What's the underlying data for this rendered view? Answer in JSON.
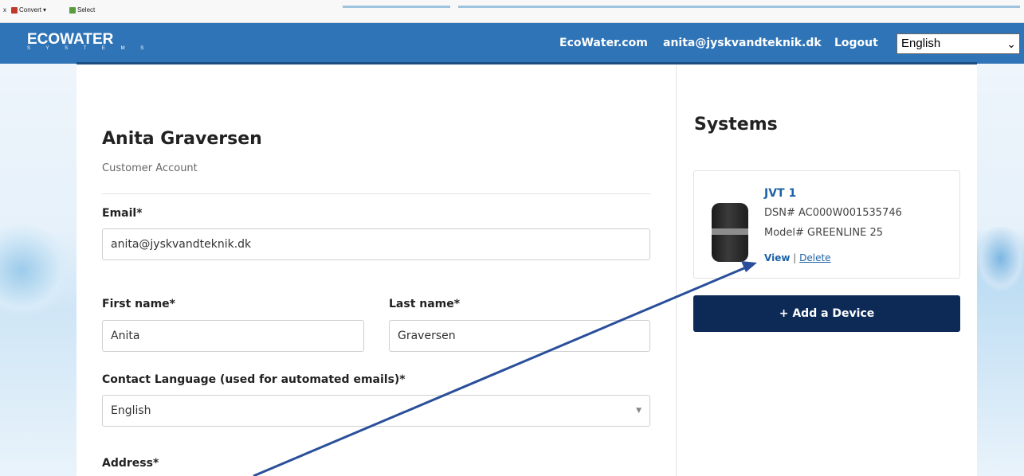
{
  "toolbar": {
    "close": "x",
    "convert_label": "Convert",
    "select_label": "Select"
  },
  "header": {
    "logo_text": "ECOWATER",
    "logo_sub": "S Y S T E M S",
    "nav": [
      {
        "label": "EcoWater.com"
      },
      {
        "label": "anita@jyskvandteknik.dk"
      },
      {
        "label": "Logout"
      }
    ],
    "language": "English"
  },
  "profile": {
    "name": "Anita Graversen",
    "subtitle": "Customer Account",
    "email_label": "Email*",
    "email_value": "anita@jyskvandteknik.dk",
    "first_name_label": "First name*",
    "first_name_value": "Anita",
    "last_name_label": "Last name*",
    "last_name_value": "Graversen",
    "contact_language_label": "Contact Language (used for automated emails)*",
    "contact_language_value": "English",
    "address_label": "Address*"
  },
  "systems": {
    "title": "Systems",
    "devices": [
      {
        "name": "JVT 1",
        "dsn": "DSN# AC000W001535746",
        "model": "Model# GREENLINE 25",
        "view_label": "View",
        "separator": "|",
        "delete_label": "Delete"
      }
    ],
    "add_button": "+ Add a Device"
  },
  "colors": {
    "header_bg": "#2f74b7",
    "link": "#1d62a6",
    "button_bg": "#0d2a57",
    "arrow": "#2a4f9a"
  }
}
